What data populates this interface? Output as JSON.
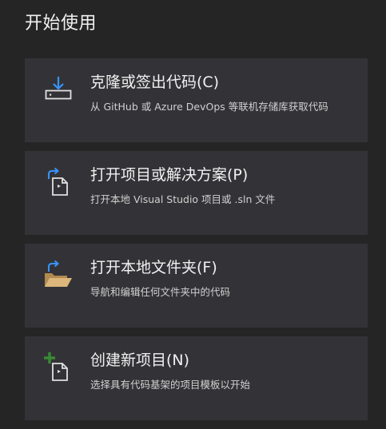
{
  "page": {
    "title": "开始使用"
  },
  "cards": [
    {
      "icon": "clone-download-icon",
      "title": "克隆或签出代码(C)",
      "description": "从 GitHub 或 Azure DevOps 等联机存储库获取代码"
    },
    {
      "icon": "open-project-icon",
      "title": "打开项目或解决方案(P)",
      "description": "打开本地 Visual Studio 项目或 .sln 文件"
    },
    {
      "icon": "open-folder-icon",
      "title": "打开本地文件夹(F)",
      "description": "导航和编辑任何文件夹中的代码"
    },
    {
      "icon": "new-project-icon",
      "title": "创建新项目(N)",
      "description": "选择具有代码基架的项目模板以开始"
    }
  ],
  "colors": {
    "background": "#252526",
    "card": "#333337",
    "accent_blue": "#3794ff",
    "folder_yellow": "#dcb67a",
    "add_green": "#388a34"
  }
}
